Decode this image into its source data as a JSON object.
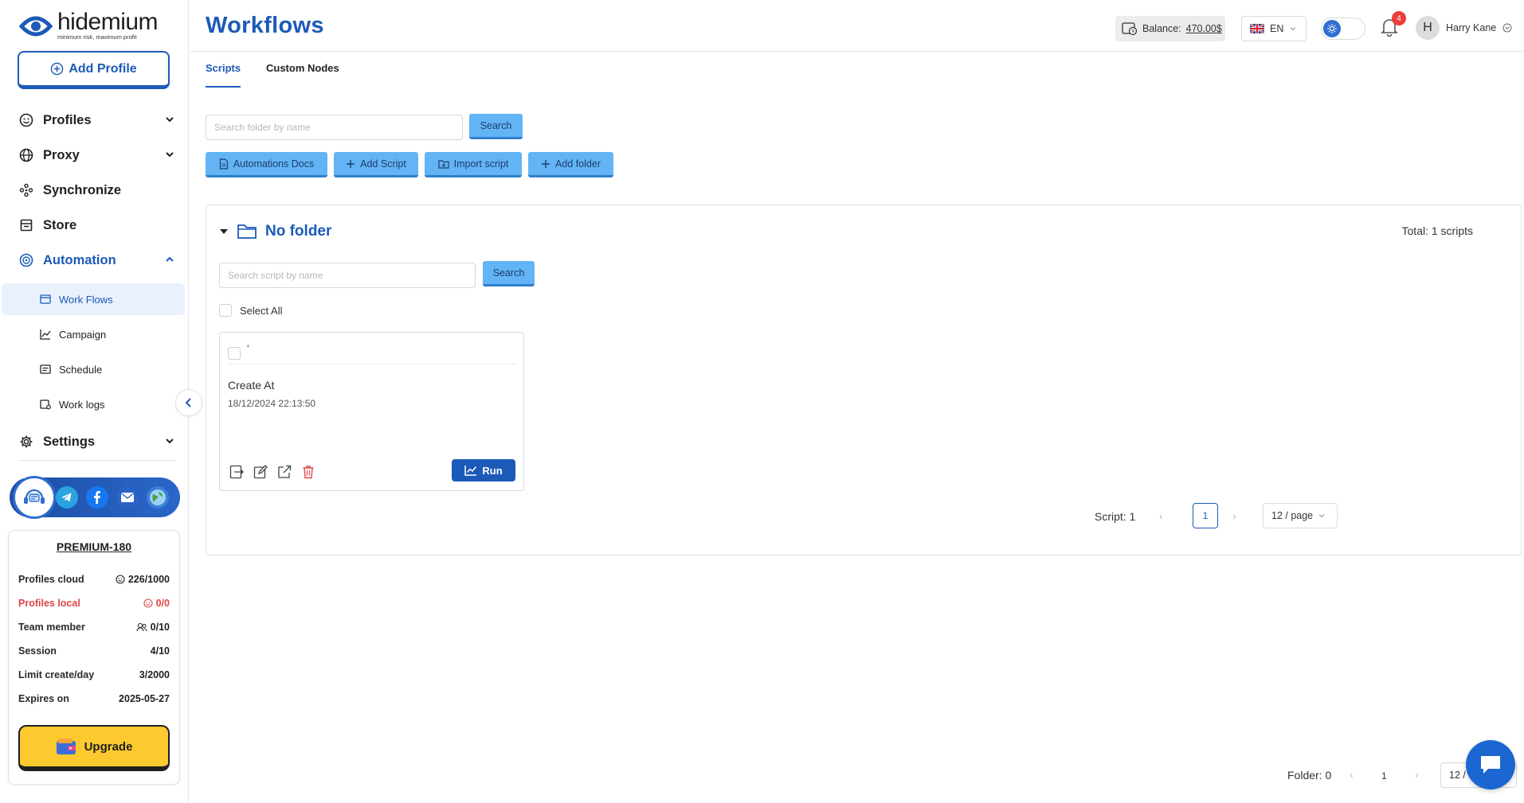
{
  "brand": {
    "name": "hidemium",
    "tagline": "minimum risk, maximum profit"
  },
  "sidebar": {
    "add_profile": "Add Profile",
    "items": [
      {
        "label": "Profiles"
      },
      {
        "label": "Proxy"
      },
      {
        "label": "Synchronize"
      },
      {
        "label": "Store"
      },
      {
        "label": "Automation"
      },
      {
        "label": "Settings"
      }
    ],
    "automation_sub": [
      {
        "label": "Work Flows"
      },
      {
        "label": "Campaign"
      },
      {
        "label": "Schedule"
      },
      {
        "label": "Work logs"
      }
    ]
  },
  "plan": {
    "title": "PREMIUM-180",
    "rows": [
      {
        "label": "Profiles cloud",
        "value": "226/1000"
      },
      {
        "label": "Profiles local",
        "value": "0/0"
      },
      {
        "label": "Team member",
        "value": "0/10"
      },
      {
        "label": "Session",
        "value": "4/10"
      },
      {
        "label": "Limit create/day",
        "value": "3/2000"
      },
      {
        "label": "Expires on",
        "value": "2025-05-27"
      }
    ],
    "upgrade": "Upgrade"
  },
  "header": {
    "title": "Workflows",
    "balance_label": "Balance:",
    "balance_amount": "470.00$",
    "language": "EN",
    "notification_count": "4",
    "user_initial": "H",
    "user_name": "Harry Kane"
  },
  "tabs": [
    {
      "label": "Scripts"
    },
    {
      "label": "Custom Nodes"
    }
  ],
  "toolbar": {
    "folder_search_placeholder": "Search folder by name",
    "search": "Search",
    "docs": "Automations Docs",
    "add_script": "Add Script",
    "import_script": "Import script",
    "add_folder": "Add folder"
  },
  "folder": {
    "name": "No folder",
    "total": "Total: 1 scripts",
    "script_search_placeholder": "Search script by name",
    "search": "Search",
    "select_all": "Select All",
    "script": {
      "name": "'",
      "created_label": "Create At",
      "created_value": "18/12/2024 22:13:50",
      "run": "Run"
    },
    "pagination": {
      "label": "Script: 1",
      "page": "1",
      "page_size": "12 / page"
    }
  },
  "folder_pagination": {
    "label": "Folder: 0",
    "page": "1",
    "page_size": "12 /"
  },
  "colors": {
    "primary": "#1c5ab8",
    "button_light": "#62b4f5",
    "upgrade": "#fcc92e",
    "danger": "#e04646"
  }
}
